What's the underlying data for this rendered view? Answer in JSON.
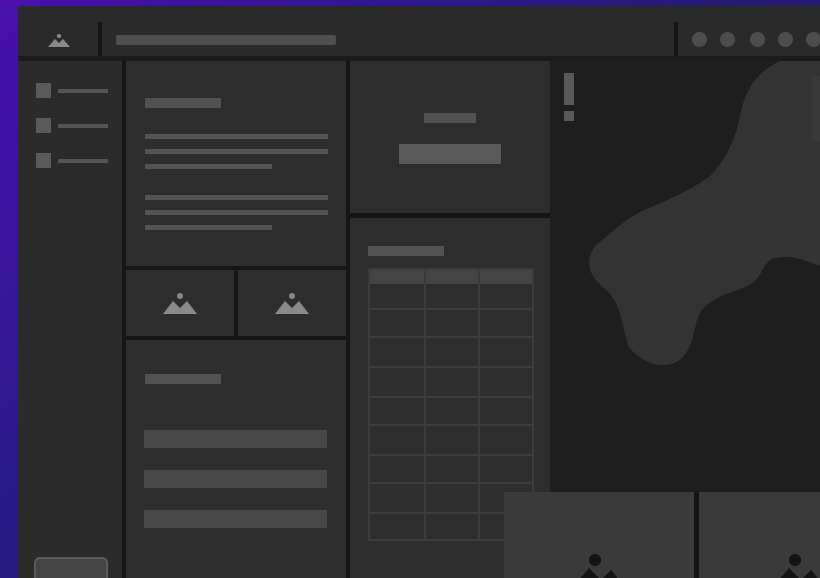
{
  "window": {
    "logo_icon": "image-icon",
    "window_controls": [
      "control-1",
      "control-2",
      "control-3",
      "control-4",
      "control-5"
    ]
  },
  "sidebar": {
    "items": [
      {
        "icon": "square-icon"
      },
      {
        "icon": "square-icon"
      },
      {
        "icon": "square-icon"
      }
    ]
  },
  "main": {
    "image_tiles": [
      {
        "icon": "image-icon"
      },
      {
        "icon": "image-icon"
      }
    ],
    "list_rows": 4,
    "table": {
      "columns": 3,
      "rows": 9
    }
  },
  "map": {
    "alert_icon": "exclamation-icon"
  },
  "gallery": {
    "thumbnails": [
      {
        "icon": "image-icon"
      },
      {
        "icon": "image-icon"
      }
    ]
  },
  "colors": {
    "backdrop": "#4a0fb0",
    "surface": "#2b2b2b",
    "placeholder": "#525252",
    "map_bg": "#1e1e1e",
    "land": "#333333"
  }
}
